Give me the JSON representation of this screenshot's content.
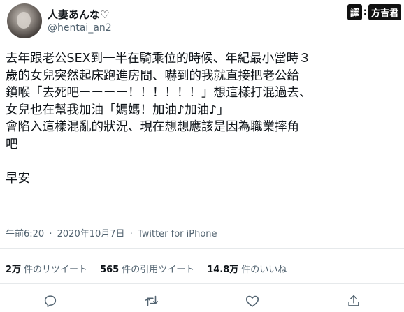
{
  "user": {
    "display_name": "人妻あんな♡",
    "handle": "@hentai_an2"
  },
  "watermark": {
    "left": "譯",
    "colon": ":",
    "right": "方吉君"
  },
  "tweet": {
    "lines": [
      "去年跟老公SEX到一半在騎乘位的時候、年紀最小當時３",
      "歲的女兒突然起床跑進房間、嚇到的我就直接把老公給",
      "鎖喉「去死吧ーーーー！！！！！！」想這樣打混過去、",
      "女兒也在幫我加油「媽媽！加油♪加油♪」",
      "會陷入這樣混亂的狀況、現在想想應該是因為職業摔角",
      "吧"
    ],
    "closing": "早安"
  },
  "meta": {
    "time": "午前6:20",
    "sep1": "·",
    "date": "2020年10月7日",
    "sep2": "·",
    "source": "Twitter for iPhone"
  },
  "stats": {
    "retweets_count": "2万",
    "retweets_label": "件のリツイート",
    "quotes_count": "565",
    "quotes_label": "件の引用ツイート",
    "likes_count": "14.8万",
    "likes_label": "件のいいね"
  },
  "actions": {
    "icons": [
      "reply-icon",
      "retweet-icon",
      "like-icon",
      "share-icon"
    ]
  },
  "colors": {
    "text": "#0f1419",
    "secondary": "#536471",
    "divider": "#e6e9eb"
  }
}
